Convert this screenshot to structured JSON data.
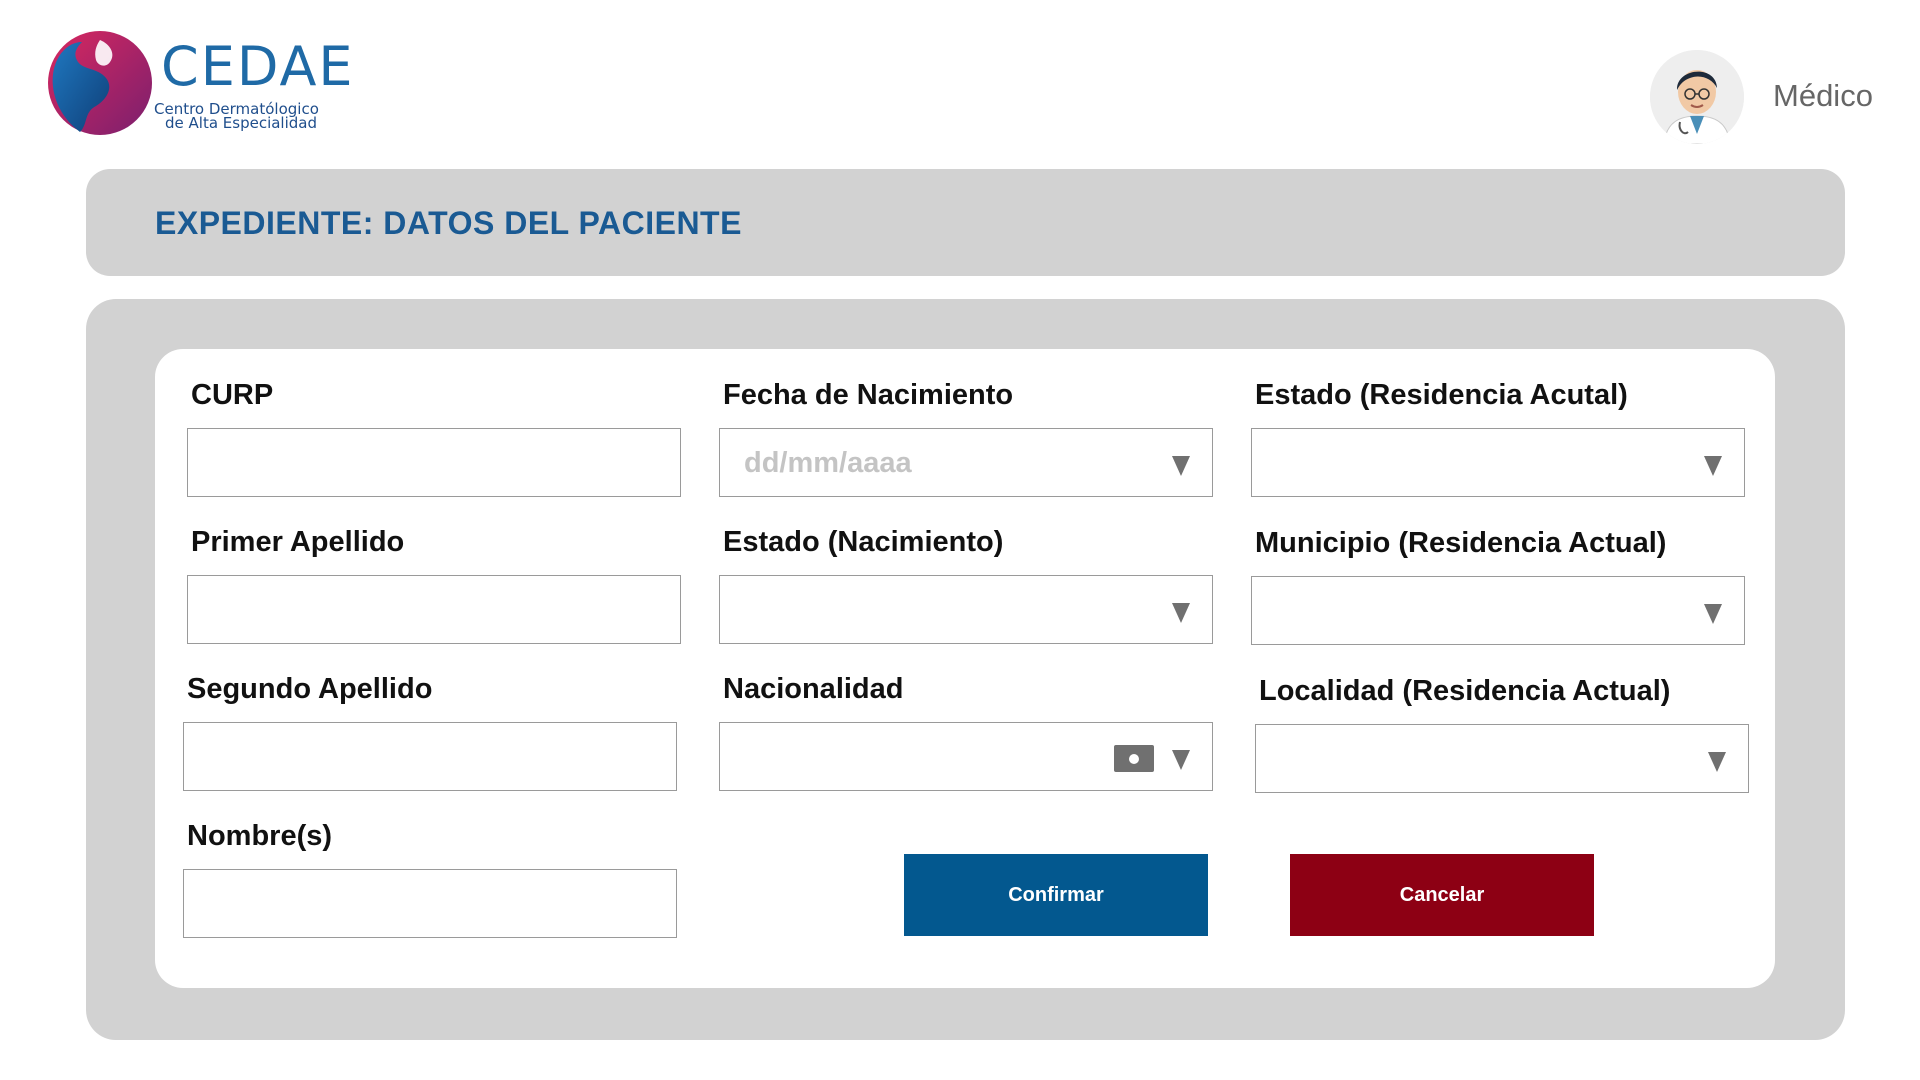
{
  "header": {
    "logo_name": "CEDAE",
    "logo_sub_line1": "Centro Dermatólogico",
    "logo_sub_line2": "de Alta Especialidad",
    "avatar_icon": "doctor-avatar",
    "role": "Médico"
  },
  "page": {
    "title": "EXPEDIENTE: DATOS DEL PACIENTE"
  },
  "form": {
    "curp": {
      "label": "CURP",
      "value": ""
    },
    "primer_apellido": {
      "label": "Primer Apellido",
      "value": ""
    },
    "segundo_apellido": {
      "label": "Segundo Apellido",
      "value": ""
    },
    "nombres": {
      "label": "Nombre(s)",
      "value": ""
    },
    "fecha_nacimiento": {
      "label": "Fecha de Nacimiento",
      "placeholder": "dd/mm/aaaa",
      "value": ""
    },
    "estado_nacimiento": {
      "label": "Estado (Nacimiento)",
      "value": ""
    },
    "nacionalidad": {
      "label": "Nacionalidad",
      "value": ""
    },
    "estado_residencia": {
      "label": "Estado (Residencia Acutal)",
      "value": ""
    },
    "municipio_residencia": {
      "label": "Municipio (Residencia Actual)",
      "value": ""
    },
    "localidad_residencia": {
      "label": "Localidad (Residencia Actual)",
      "value": ""
    }
  },
  "actions": {
    "confirm_label": "Confirmar",
    "cancel_label": "Cancelar"
  },
  "colors": {
    "brand_blue": "#1a5a93",
    "confirm": "#03588f",
    "cancel": "#8d0014",
    "panel": "#d2d2d2"
  }
}
